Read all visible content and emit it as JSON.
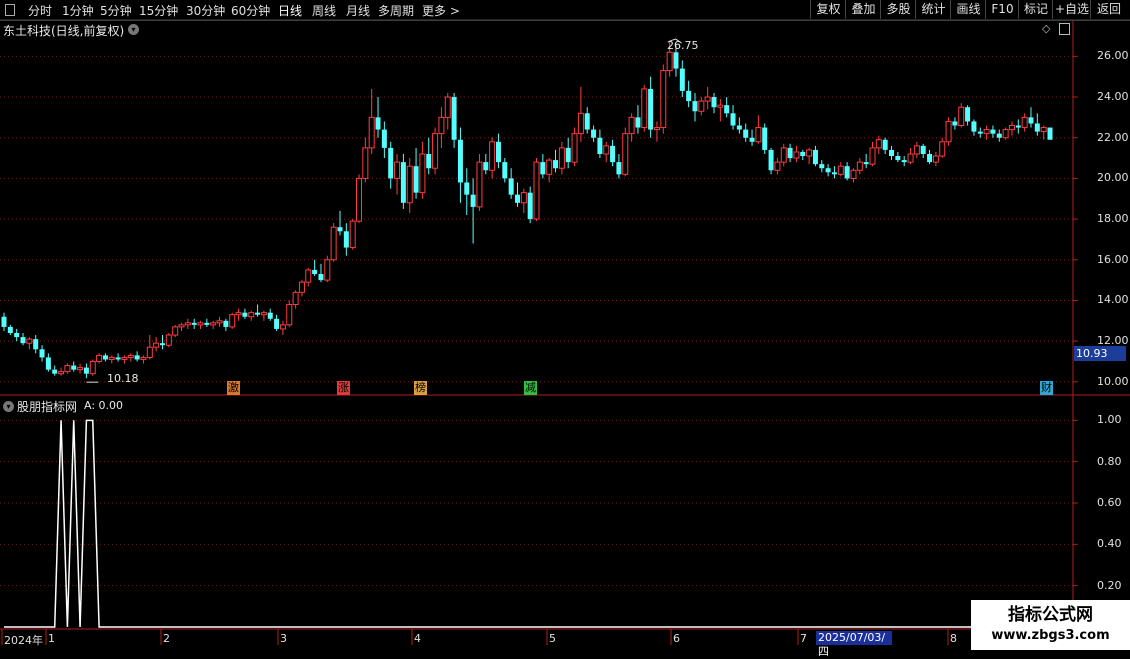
{
  "toolbar": {
    "periods": [
      "分时",
      "1分钟",
      "5分钟",
      "15分钟",
      "30分钟",
      "60分钟",
      "日线",
      "周线",
      "月线",
      "多周期",
      "更多 >"
    ],
    "active_period": "日线",
    "right_buttons": [
      "复权",
      "叠加",
      "多股",
      "统计",
      "画线",
      "F10",
      "标记",
      "+自选",
      "返回"
    ]
  },
  "main_panel": {
    "title": "东土科技(日线,前复权)",
    "high_label": "26.75",
    "low_label": "10.18",
    "current_price": "10.93",
    "y_ticks": [
      "26.00",
      "24.00",
      "22.00",
      "20.00",
      "18.00",
      "16.00",
      "14.00",
      "12.00",
      "10.00"
    ],
    "signals": [
      {
        "text": "激",
        "color": "#d87a30"
      },
      {
        "text": "涨",
        "color": "#e03a3a"
      },
      {
        "text": "榜",
        "color": "#d8a040"
      },
      {
        "text": "减",
        "color": "#30c040"
      },
      {
        "text": "财",
        "color": "#30a8d8"
      }
    ]
  },
  "indicator_panel": {
    "title": "股朋指标网",
    "value_label": "A: 0.00",
    "y_ticks": [
      "1.00",
      "0.80",
      "0.60",
      "0.40",
      "0.20"
    ]
  },
  "x_axis": {
    "labels": [
      "2024年",
      "1",
      "2",
      "3",
      "4",
      "5",
      "6",
      "7",
      "8"
    ],
    "highlight_date": "2025/07/03/四"
  },
  "watermark": {
    "title": "指标公式网",
    "url": "www.zbgs3.com"
  },
  "colors": {
    "up": "#ff3c3c",
    "down": "#54ffff",
    "grid": "#7a1a1a",
    "axis": "#b01e1e",
    "indicator_line": "#ffffff"
  },
  "chart_data": {
    "type": "candlestick",
    "price_scale": {
      "min": 9.5,
      "max": 27.0
    },
    "ohlc": [
      [
        13.2,
        13.4,
        12.5,
        12.7
      ],
      [
        12.7,
        12.8,
        12.3,
        12.4
      ],
      [
        12.4,
        12.6,
        12.0,
        12.2
      ],
      [
        12.2,
        12.4,
        11.8,
        11.9
      ],
      [
        11.9,
        12.2,
        11.6,
        12.1
      ],
      [
        12.1,
        12.3,
        11.4,
        11.6
      ],
      [
        11.6,
        11.8,
        11.0,
        11.2
      ],
      [
        11.2,
        11.4,
        10.5,
        10.6
      ],
      [
        10.6,
        10.8,
        10.3,
        10.4
      ],
      [
        10.4,
        10.7,
        10.3,
        10.5
      ],
      [
        10.5,
        10.9,
        10.4,
        10.8
      ],
      [
        10.8,
        11.0,
        10.5,
        10.6
      ],
      [
        10.6,
        10.9,
        10.4,
        10.7
      ],
      [
        10.7,
        10.9,
        10.18,
        10.4
      ],
      [
        10.4,
        11.1,
        10.3,
        11.0
      ],
      [
        11.0,
        11.4,
        10.9,
        11.3
      ],
      [
        11.3,
        11.4,
        11.0,
        11.1
      ],
      [
        11.1,
        11.3,
        10.9,
        11.2
      ],
      [
        11.2,
        11.4,
        11.0,
        11.1
      ],
      [
        11.1,
        11.3,
        10.9,
        11.2
      ],
      [
        11.2,
        11.4,
        11.0,
        11.3
      ],
      [
        11.3,
        11.5,
        11.0,
        11.1
      ],
      [
        11.1,
        11.3,
        10.9,
        11.2
      ],
      [
        11.2,
        12.3,
        11.1,
        11.7
      ],
      [
        11.7,
        12.2,
        11.5,
        11.9
      ],
      [
        11.9,
        12.3,
        11.6,
        11.8
      ],
      [
        11.8,
        12.4,
        11.7,
        12.3
      ],
      [
        12.3,
        12.8,
        12.2,
        12.7
      ],
      [
        12.7,
        12.9,
        12.5,
        12.8
      ],
      [
        12.8,
        13.1,
        12.6,
        12.9
      ],
      [
        12.9,
        13.1,
        12.6,
        12.8
      ],
      [
        12.8,
        13.0,
        12.6,
        12.9
      ],
      [
        12.9,
        13.1,
        12.7,
        12.8
      ],
      [
        12.8,
        13.0,
        12.6,
        12.9
      ],
      [
        12.9,
        13.2,
        12.7,
        13.0
      ],
      [
        13.0,
        13.1,
        12.5,
        12.7
      ],
      [
        12.7,
        13.4,
        12.6,
        13.3
      ],
      [
        13.3,
        13.6,
        13.0,
        13.4
      ],
      [
        13.4,
        13.6,
        13.1,
        13.2
      ],
      [
        13.2,
        13.5,
        13.0,
        13.4
      ],
      [
        13.4,
        13.8,
        13.2,
        13.3
      ],
      [
        13.3,
        13.5,
        13.0,
        13.4
      ],
      [
        13.4,
        13.6,
        13.0,
        13.1
      ],
      [
        13.1,
        13.3,
        12.5,
        12.6
      ],
      [
        12.6,
        13.0,
        12.3,
        12.8
      ],
      [
        12.8,
        14.0,
        12.7,
        13.8
      ],
      [
        13.8,
        14.5,
        13.6,
        14.4
      ],
      [
        14.4,
        15.0,
        14.2,
        14.9
      ],
      [
        14.9,
        15.6,
        14.7,
        15.5
      ],
      [
        15.5,
        16.0,
        15.2,
        15.3
      ],
      [
        15.3,
        15.8,
        14.9,
        15.0
      ],
      [
        15.0,
        16.2,
        14.9,
        16.0
      ],
      [
        16.0,
        17.8,
        15.9,
        17.6
      ],
      [
        17.6,
        18.4,
        17.2,
        17.4
      ],
      [
        17.4,
        17.8,
        16.2,
        16.6
      ],
      [
        16.6,
        18.0,
        16.5,
        17.9
      ],
      [
        17.9,
        20.2,
        17.8,
        20.0
      ],
      [
        20.0,
        22.0,
        19.8,
        21.5
      ],
      [
        21.5,
        24.4,
        21.2,
        23.0
      ],
      [
        23.0,
        24.0,
        22.0,
        22.4
      ],
      [
        22.4,
        22.8,
        21.0,
        21.5
      ],
      [
        21.5,
        21.8,
        19.5,
        20.0
      ],
      [
        20.0,
        21.2,
        19.2,
        20.8
      ],
      [
        20.8,
        21.2,
        18.5,
        18.8
      ],
      [
        18.8,
        21.0,
        18.3,
        20.6
      ],
      [
        20.6,
        21.5,
        19.0,
        19.3
      ],
      [
        19.3,
        21.8,
        19.0,
        21.2
      ],
      [
        21.2,
        22.0,
        20.2,
        20.5
      ],
      [
        20.5,
        22.5,
        20.2,
        22.2
      ],
      [
        22.2,
        23.5,
        21.5,
        23.0
      ],
      [
        23.0,
        24.2,
        22.4,
        24.0
      ],
      [
        24.0,
        24.2,
        21.5,
        21.9
      ],
      [
        21.9,
        22.5,
        18.8,
        19.8
      ],
      [
        19.8,
        20.5,
        18.2,
        19.2
      ],
      [
        19.2,
        20.0,
        16.8,
        18.6
      ],
      [
        18.6,
        21.2,
        18.4,
        20.8
      ],
      [
        20.8,
        21.2,
        20.2,
        20.4
      ],
      [
        20.4,
        22.0,
        20.0,
        21.8
      ],
      [
        21.8,
        22.2,
        20.5,
        20.8
      ],
      [
        20.8,
        21.0,
        19.8,
        20.0
      ],
      [
        20.0,
        20.5,
        19.0,
        19.2
      ],
      [
        19.2,
        19.8,
        18.6,
        18.8
      ],
      [
        18.8,
        19.5,
        18.3,
        19.3
      ],
      [
        19.3,
        19.6,
        17.8,
        18.0
      ],
      [
        18.0,
        21.0,
        17.9,
        20.8
      ],
      [
        20.8,
        21.2,
        20.0,
        20.2
      ],
      [
        20.2,
        21.0,
        19.8,
        20.9
      ],
      [
        20.9,
        21.4,
        20.3,
        20.5
      ],
      [
        20.5,
        21.8,
        20.2,
        21.5
      ],
      [
        21.5,
        22.0,
        20.5,
        20.8
      ],
      [
        20.8,
        22.5,
        20.6,
        22.2
      ],
      [
        22.2,
        24.5,
        21.8,
        23.2
      ],
      [
        23.2,
        23.5,
        22.2,
        22.4
      ],
      [
        22.4,
        22.6,
        21.8,
        22.0
      ],
      [
        22.0,
        22.4,
        21.0,
        21.2
      ],
      [
        21.2,
        21.8,
        20.8,
        21.6
      ],
      [
        21.6,
        21.9,
        20.6,
        20.8
      ],
      [
        20.8,
        21.2,
        20.0,
        20.2
      ],
      [
        20.2,
        22.5,
        20.1,
        22.2
      ],
      [
        22.2,
        23.2,
        21.8,
        23.0
      ],
      [
        23.0,
        23.6,
        22.2,
        22.5
      ],
      [
        22.5,
        24.6,
        22.3,
        24.4
      ],
      [
        24.4,
        25.0,
        22.0,
        22.4
      ],
      [
        22.4,
        22.8,
        21.8,
        22.5
      ],
      [
        22.5,
        25.6,
        22.2,
        25.3
      ],
      [
        25.3,
        26.75,
        25.0,
        26.2
      ],
      [
        26.2,
        26.5,
        25.0,
        25.4
      ],
      [
        25.4,
        25.8,
        24.0,
        24.3
      ],
      [
        24.3,
        24.8,
        23.5,
        23.8
      ],
      [
        23.8,
        24.2,
        22.8,
        23.3
      ],
      [
        23.3,
        24.0,
        23.1,
        23.8
      ],
      [
        23.8,
        24.5,
        23.4,
        24.0
      ],
      [
        24.0,
        24.2,
        23.2,
        23.5
      ],
      [
        23.5,
        23.9,
        22.8,
        23.6
      ],
      [
        23.6,
        24.0,
        23.0,
        23.2
      ],
      [
        23.2,
        23.6,
        22.4,
        22.6
      ],
      [
        22.6,
        23.0,
        22.2,
        22.4
      ],
      [
        22.4,
        22.7,
        21.8,
        22.0
      ],
      [
        22.0,
        22.4,
        21.6,
        21.8
      ],
      [
        21.8,
        23.1,
        21.7,
        22.5
      ],
      [
        22.5,
        22.7,
        21.2,
        21.4
      ],
      [
        21.4,
        21.5,
        20.2,
        20.4
      ],
      [
        20.4,
        21.0,
        20.2,
        20.8
      ],
      [
        20.8,
        21.7,
        20.6,
        21.5
      ],
      [
        21.5,
        21.7,
        20.8,
        21.0
      ],
      [
        21.0,
        21.6,
        20.8,
        21.3
      ],
      [
        21.3,
        21.4,
        20.9,
        21.1
      ],
      [
        21.1,
        21.5,
        20.7,
        21.4
      ],
      [
        21.4,
        21.6,
        20.6,
        20.7
      ],
      [
        20.7,
        20.9,
        20.3,
        20.5
      ],
      [
        20.5,
        20.7,
        20.1,
        20.3
      ],
      [
        20.3,
        20.6,
        20.0,
        20.2
      ],
      [
        20.2,
        20.8,
        20.1,
        20.6
      ],
      [
        20.6,
        20.8,
        19.9,
        20.0
      ],
      [
        20.0,
        20.5,
        19.8,
        20.4
      ],
      [
        20.4,
        21.0,
        20.2,
        20.8
      ],
      [
        20.8,
        21.2,
        20.5,
        20.7
      ],
      [
        20.7,
        21.8,
        20.6,
        21.5
      ],
      [
        21.5,
        22.1,
        21.2,
        21.9
      ],
      [
        21.9,
        22.0,
        21.2,
        21.4
      ],
      [
        21.4,
        21.6,
        20.9,
        21.1
      ],
      [
        21.1,
        21.3,
        20.8,
        20.9
      ],
      [
        20.9,
        21.1,
        20.6,
        20.8
      ],
      [
        20.8,
        21.5,
        20.7,
        21.2
      ],
      [
        21.2,
        21.8,
        21.0,
        21.6
      ],
      [
        21.6,
        21.7,
        21.0,
        21.2
      ],
      [
        21.2,
        21.4,
        20.7,
        20.8
      ],
      [
        20.8,
        21.3,
        20.6,
        21.1
      ],
      [
        21.1,
        22.0,
        21.0,
        21.8
      ],
      [
        21.8,
        23.0,
        21.6,
        22.8
      ],
      [
        22.8,
        23.0,
        22.4,
        22.6
      ],
      [
        22.6,
        23.7,
        22.5,
        23.5
      ],
      [
        23.5,
        23.6,
        22.6,
        22.8
      ],
      [
        22.8,
        22.9,
        22.1,
        22.3
      ],
      [
        22.3,
        22.5,
        22.0,
        22.2
      ],
      [
        22.2,
        22.6,
        21.9,
        22.4
      ],
      [
        22.4,
        22.6,
        22.0,
        22.2
      ],
      [
        22.2,
        22.4,
        21.8,
        22.0
      ],
      [
        22.0,
        22.5,
        21.9,
        22.4
      ],
      [
        22.4,
        22.8,
        22.1,
        22.6
      ],
      [
        22.6,
        22.9,
        22.2,
        22.5
      ],
      [
        22.5,
        23.2,
        22.3,
        23.0
      ],
      [
        23.0,
        23.5,
        22.5,
        22.7
      ],
      [
        22.7,
        23.2,
        22.1,
        22.3
      ],
      [
        22.3,
        22.6,
        21.9,
        22.5
      ],
      [
        22.5,
        22.5,
        21.9,
        21.9
      ]
    ],
    "indicator": {
      "range": [
        0,
        1.05
      ],
      "values_by_candle": [
        0,
        0,
        0,
        0,
        0,
        0,
        0,
        0,
        0,
        1,
        0,
        1,
        0,
        1,
        1,
        0,
        0,
        0,
        0,
        0,
        0,
        0,
        0,
        0,
        0,
        0,
        0,
        0,
        0,
        0,
        0,
        0,
        0,
        0,
        0,
        0,
        0,
        0,
        0,
        0,
        0,
        0,
        0,
        0,
        0,
        0,
        0,
        0,
        0,
        0,
        0,
        0,
        0,
        0,
        0,
        0,
        0,
        0,
        0,
        0,
        0,
        0,
        0,
        0,
        0,
        0,
        0,
        0,
        0,
        0,
        0,
        0,
        0,
        0,
        0,
        0,
        0,
        0,
        0,
        0,
        0,
        0,
        0,
        0,
        0,
        0,
        0,
        0,
        0,
        0,
        0,
        0,
        0,
        0,
        0,
        0,
        0,
        0,
        0,
        0,
        0,
        0,
        0,
        0,
        0,
        0,
        0,
        0,
        0,
        0,
        0,
        0,
        0,
        0,
        0,
        0,
        0,
        0,
        0,
        0,
        0,
        0,
        0,
        0,
        0,
        0,
        0,
        0,
        0,
        0,
        0,
        0,
        0,
        0,
        0,
        0,
        0,
        0,
        0,
        0,
        0,
        0,
        0,
        0,
        0,
        0,
        0,
        0,
        0,
        0,
        0,
        0,
        0,
        0,
        0,
        0,
        0,
        0,
        0,
        0,
        0,
        0,
        0,
        0,
        0,
        0,
        0,
        0
      ]
    }
  }
}
